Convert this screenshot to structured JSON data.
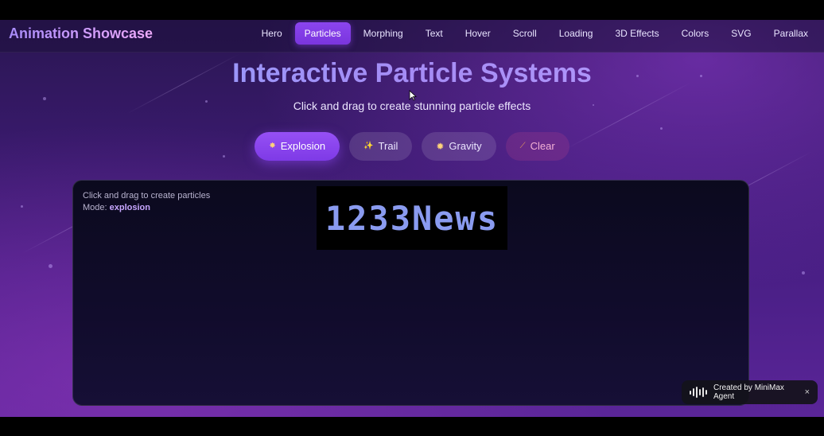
{
  "app": {
    "brand": "Animation Showcase"
  },
  "nav": {
    "items": [
      {
        "label": "Hero"
      },
      {
        "label": "Particles",
        "active": true
      },
      {
        "label": "Morphing"
      },
      {
        "label": "Text"
      },
      {
        "label": "Hover"
      },
      {
        "label": "Scroll"
      },
      {
        "label": "Loading"
      },
      {
        "label": "3D Effects"
      },
      {
        "label": "Colors"
      },
      {
        "label": "SVG"
      },
      {
        "label": "Parallax"
      }
    ]
  },
  "hero": {
    "title": "Interactive Particle Systems",
    "subtitle": "Click and drag to create stunning particle effects"
  },
  "modes": {
    "explosion": {
      "label": "Explosion",
      "icon": "explosion-icon"
    },
    "trail": {
      "label": "Trail",
      "icon": "sparkles-icon"
    },
    "gravity": {
      "label": "Gravity",
      "icon": "star-icon"
    },
    "clear": {
      "label": "Clear",
      "icon": "broom-icon"
    }
  },
  "canvas": {
    "hint": "Click and drag to create particles",
    "mode_label": "Mode:",
    "mode_value": "explosion"
  },
  "watermark": {
    "text": "1233News"
  },
  "toast": {
    "text": "Created by MiniMax Agent",
    "close": "×"
  },
  "colors": {
    "accent": "#8b45ee",
    "title": "#9aa6ff"
  }
}
